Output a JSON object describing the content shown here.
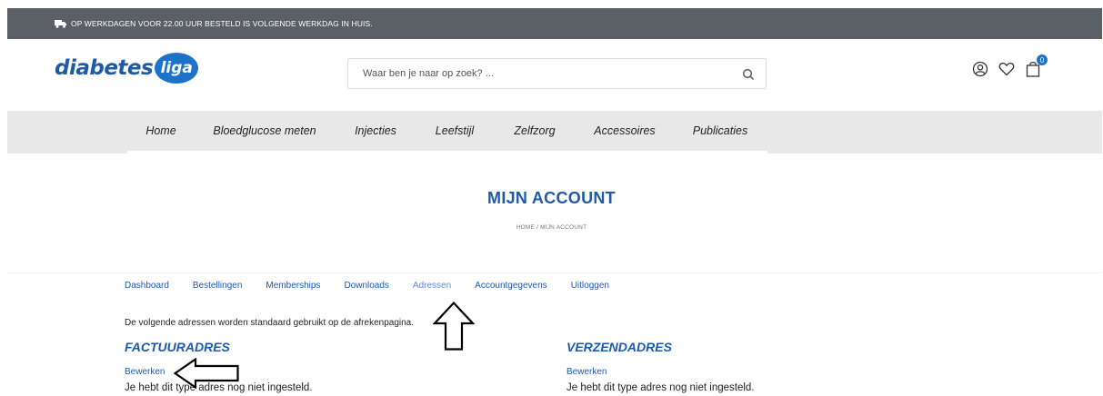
{
  "topbar": {
    "message": "OP WERKDAGEN VOOR 22.00 UUR BESTELD IS VOLGENDE WERKDAG IN HUIS."
  },
  "logo": {
    "word": "diabetes",
    "bubble": "liga"
  },
  "search": {
    "placeholder": "Waar ben je naar op zoek? ..."
  },
  "cart": {
    "count": "0"
  },
  "nav": {
    "items": [
      "Home",
      "Bloedglucose meten",
      "Injecties",
      "Leefstijl",
      "Zelfzorg",
      "Accessoires",
      "Publicaties"
    ]
  },
  "page": {
    "title": "MIJN ACCOUNT",
    "breadcrumb": "HOME / MIJN ACCOUNT"
  },
  "account_nav": {
    "items": [
      "Dashboard",
      "Bestellingen",
      "Memberships",
      "Downloads",
      "Adressen",
      "Accountgegevens",
      "Uitloggen"
    ],
    "active": "Adressen"
  },
  "content": {
    "intro": "De volgende adressen worden standaard gebruikt op de afrekenpagina.",
    "billing": {
      "title": "FACTUURADRES",
      "edit": "Bewerken",
      "empty": "Je hebt dit type adres nog niet ingesteld."
    },
    "shipping": {
      "title": "VERZENDADRES",
      "edit": "Bewerken",
      "empty": "Je hebt dit type adres nog niet ingesteld."
    }
  },
  "colors": {
    "brand_blue": "#1d5aa8",
    "topbar_gray": "#5b5f66",
    "nav_gray": "#e8e8e8"
  }
}
